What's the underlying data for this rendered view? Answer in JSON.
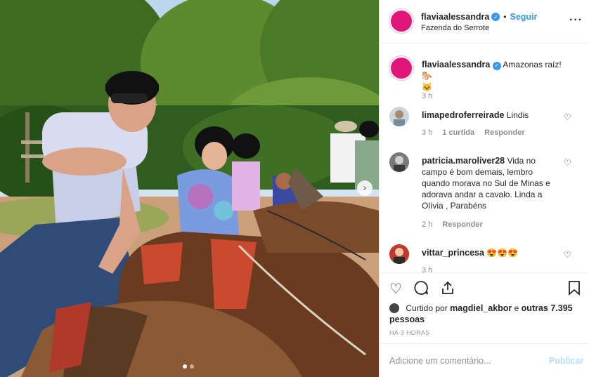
{
  "post": {
    "author": "flaviaalessandra",
    "follow_sep": "•",
    "follow_label": "Seguir",
    "location": "Fazenda do Serrote",
    "more_icon": "more-horizontal-icon",
    "caption": "Amazonas raíz! 🐎",
    "caption_extra": "🐱",
    "caption_time": "3 h"
  },
  "comments": [
    {
      "user": "limapedroferreirade",
      "text": "Lindis",
      "time": "3 h",
      "likes": "1 curtida",
      "reply": "Responder"
    },
    {
      "user": "patricia.maroliver28",
      "text": "Vida no campo é bom demais, lembro quando morava no Sul de Minas e adorava andar a cavalo. Linda a Olívia , Parabéns",
      "time": "2 h",
      "reply": "Responder"
    },
    {
      "user": "vittar_princesa",
      "text": "😍😍😍",
      "time": "3 h"
    }
  ],
  "actions": {
    "like_icon": "heart-icon",
    "comment_icon": "comment-icon",
    "share_icon": "share-icon",
    "save_icon": "bookmark-icon"
  },
  "likes": {
    "prefix": "Curtido por",
    "user": "magdiel_akbor",
    "mid": "e",
    "others": "outras 7.395 pessoas"
  },
  "time_ago": "HÁ 3 HORAS",
  "add_comment": {
    "placeholder": "Adicione um comentário...",
    "publish": "Publicar"
  },
  "colors": {
    "avatar": "#e0167b",
    "link": "#3897f0",
    "publish_disabled": "#b2dffc"
  },
  "carousel": {
    "slides": 2,
    "active": 1
  }
}
